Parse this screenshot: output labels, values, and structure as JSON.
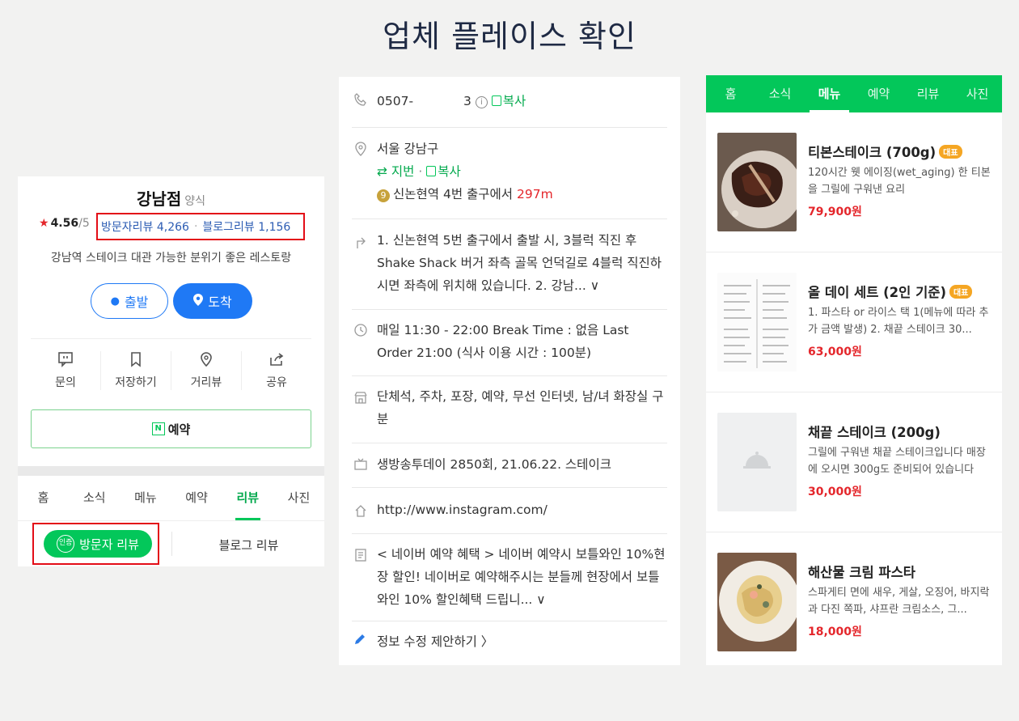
{
  "page_title": "업체 플레이스 확인",
  "panel1": {
    "name": "강남점",
    "category": "양식",
    "rating": "4.56",
    "rating_max": "/5",
    "visitor_reviews": "방문자리뷰 4,266",
    "blog_reviews": "블로그리뷰 1,156",
    "description": "강남역 스테이크 대관 가능한 분위기 좋은 레스토랑",
    "depart_label": "출발",
    "arrive_label": "도착",
    "actions": [
      {
        "label": "문의",
        "icon": "chat-icon"
      },
      {
        "label": "저장하기",
        "icon": "bookmark-icon"
      },
      {
        "label": "거리뷰",
        "icon": "pin-icon"
      },
      {
        "label": "공유",
        "icon": "share-icon"
      }
    ],
    "reserve_label": "예약",
    "reserve_badge": "N",
    "tabs": [
      "홈",
      "소식",
      "메뉴",
      "예약",
      "리뷰",
      "사진"
    ],
    "active_tab": "리뷰",
    "visitor_review_tab": "방문자 리뷰",
    "cert_badge": "인증",
    "blog_review_tab": "블로그 리뷰"
  },
  "panel2": {
    "phone_prefix": "0507-",
    "phone_suffix": "3",
    "copy_label": "복사",
    "address": "서울 강남구",
    "jibun_label": "⇄ 지번",
    "metro_line": "9",
    "metro_text": "신논현역 4번 출구에서",
    "metro_distance": "297m",
    "directions": "1. 신논현역 5번 출구에서 출발 시, 3블럭 직진 후 Shake Shack 버거 좌측 골목 언덕길로 4블럭 직진하시면 좌측에 위치해 있습니다. 2. 강남... ∨",
    "hours": "매일 11:30 - 22:00 Break Time : 없음 Last Order 21:00 (식사 이용 시간 : 100분)",
    "facilities": "단체석, 주차, 포장, 예약, 무선 인터넷, 남/녀 화장실 구분",
    "tv": "생방송투데이 2850회, 21.06.22. 스테이크",
    "website": "http://www.instagram.com/",
    "promo": "< 네이버 예약 혜택 > 네이버 예약시 보틀와인 10%현장 할인! 네이버로 예약해주시는 분들께 현장에서 보틀 와인 10% 할인혜택 드립니... ∨",
    "edit_label": "정보 수정 제안하기 〉"
  },
  "panel3": {
    "tabs": [
      "홈",
      "소식",
      "메뉴",
      "예약",
      "리뷰",
      "사진"
    ],
    "active_tab": "메뉴",
    "badge_label": "대표",
    "items": [
      {
        "name": "티본스테이크 (700g)",
        "badge": true,
        "desc": "120시간 웻 에이징(wet_aging) 한 티본을 그릴에 구워낸 요리",
        "price": "79,900원"
      },
      {
        "name": "올 데이 세트 (2인 기준)",
        "badge": true,
        "desc": "1. 파스타 or 라이스 택 1(메뉴에 따라 추가 금액 발생) 2. 채끝 스테이크 30...",
        "price": "63,000원"
      },
      {
        "name": "채끝 스테이크 (200g)",
        "badge": false,
        "desc": "그릴에 구워낸 채끝 스테이크입니다 매장에 오시면 300g도 준비되어 있습니다",
        "price": "30,000원"
      },
      {
        "name": "해산물 크림 파스타",
        "badge": false,
        "desc": "스파게티 면에 새우, 게살, 오징어, 바지락과 다진 쪽파, 샤프란 크림소스, 그...",
        "price": "18,000원"
      }
    ]
  },
  "colors": {
    "naver_green": "#03c75a",
    "highlight_red": "#e30d17",
    "link_blue": "#2c5cb3",
    "price_red": "#e4262b"
  }
}
